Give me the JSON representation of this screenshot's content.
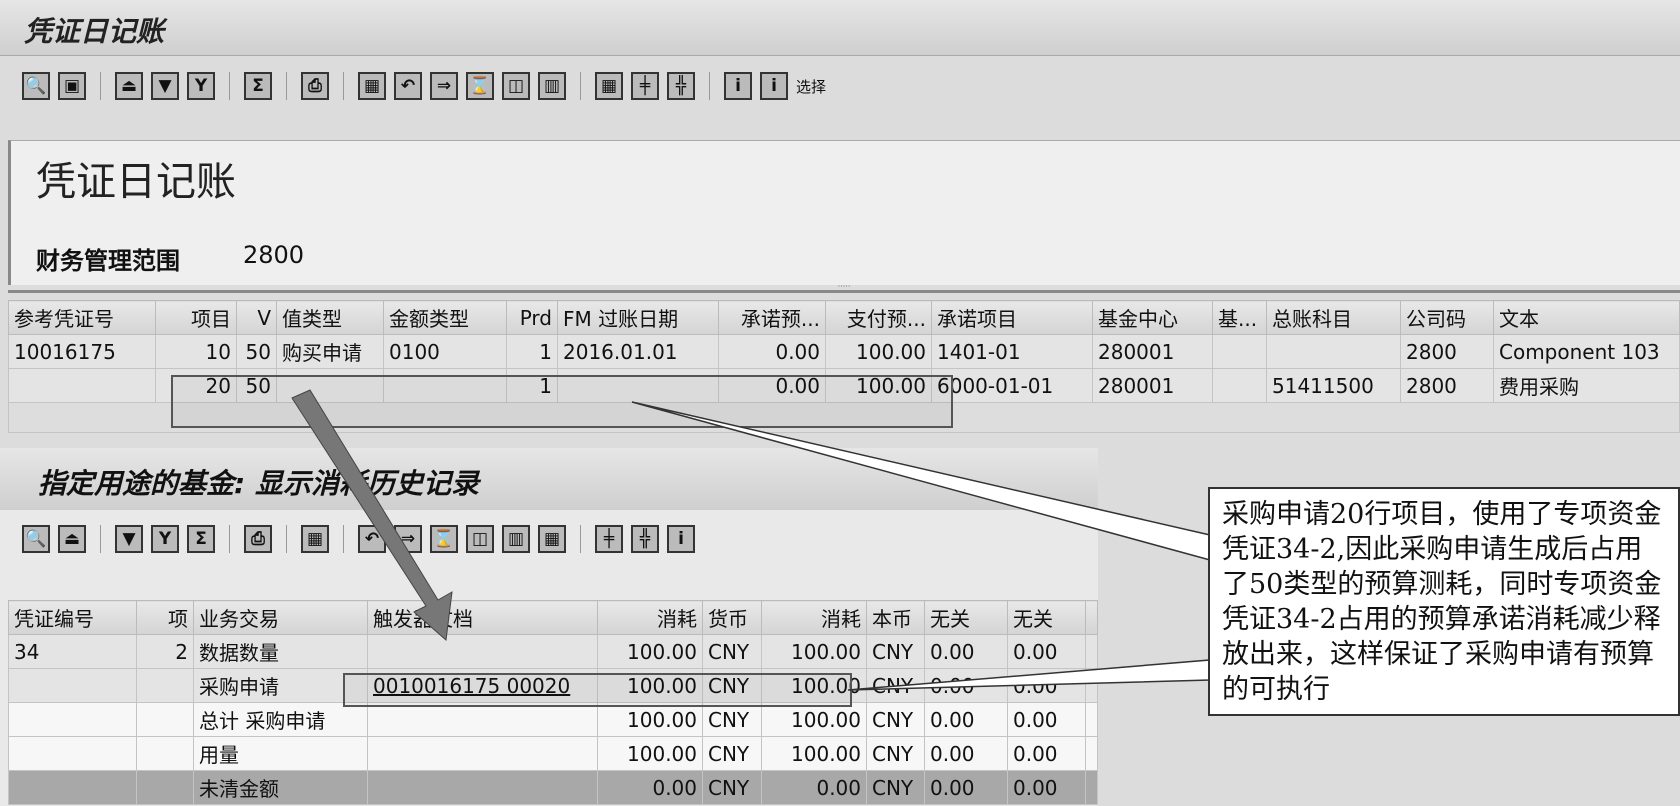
{
  "window": {
    "title": "凭证日记账"
  },
  "toolbar1": {
    "icons": [
      "🔍",
      "▣",
      "⏏",
      "▼",
      "Y",
      "Σ",
      "⎙",
      "▦",
      "↶",
      "⇒",
      "⌛",
      "◫",
      "▥",
      "▦",
      "╪",
      "╬",
      "i",
      "i"
    ],
    "select_label": "选择"
  },
  "header": {
    "title": "凭证日记账",
    "fm_area_label": "财务管理范围",
    "fm_area_value": "2800"
  },
  "table1": {
    "columns": [
      "参考凭证号",
      "项目",
      "V",
      "值类型",
      "金额类型",
      "Prd",
      "FM 过账日期",
      "承诺预...",
      "支付预...",
      "承诺项目",
      "基金中心",
      "基...",
      "总账科目",
      "公司码",
      "文本"
    ],
    "rows": [
      [
        "10016175",
        "10",
        "50",
        "购买申请",
        "0100",
        "1",
        "2016.01.01",
        "0.00",
        "100.00",
        "1401-01",
        "280001",
        "",
        "",
        "2800",
        "Component 103"
      ],
      [
        "",
        "20",
        "50",
        "",
        "",
        "1",
        "",
        "0.00",
        "100.00",
        "6000-01-01",
        "280001",
        "",
        "51411500",
        "2800",
        "费用采购"
      ]
    ]
  },
  "panel2": {
    "title": "指定用途的基金: 显示消耗历史记录",
    "toolbar_icons": [
      "🔍",
      "⏏",
      "▼",
      "Y",
      "Σ",
      "⎙",
      "▦",
      "↶",
      "⇒",
      "⌛",
      "◫",
      "▥",
      "▦",
      "╪",
      "╬",
      "i"
    ],
    "table": {
      "columns": [
        "凭证编号",
        "项",
        "业务交易",
        "触发器文档",
        "消耗",
        "货币",
        "消耗",
        "本币",
        "无关",
        "无关"
      ],
      "rows": [
        [
          "34",
          "2",
          "数据数量",
          "",
          "100.00",
          "CNY",
          "100.00",
          "CNY",
          "0.00",
          "0.00"
        ],
        [
          "",
          "",
          "采购申请",
          "0010016175 00020",
          "100.00",
          "CNY",
          "100.00",
          "CNY",
          "0.00",
          "0.00"
        ],
        [
          "",
          "",
          "总计 采购申请",
          "",
          "100.00",
          "CNY",
          "100.00",
          "CNY",
          "0.00",
          "0.00"
        ],
        [
          "",
          "",
          "用量",
          "",
          "100.00",
          "CNY",
          "100.00",
          "CNY",
          "0.00",
          "0.00"
        ],
        [
          "",
          "",
          "未清金额",
          "",
          "0.00",
          "CNY",
          "0.00",
          "CNY",
          "0.00",
          "0.00"
        ]
      ]
    }
  },
  "annotation": {
    "text": "采购申请20行项目，使用了专项资金凭证34-2,因此采购申请生成后占用了50类型的预算测耗，同时专项资金凭证34-2占用的预算承诺消耗减少释放出来，这样保证了采购申请有预算的可执行"
  }
}
